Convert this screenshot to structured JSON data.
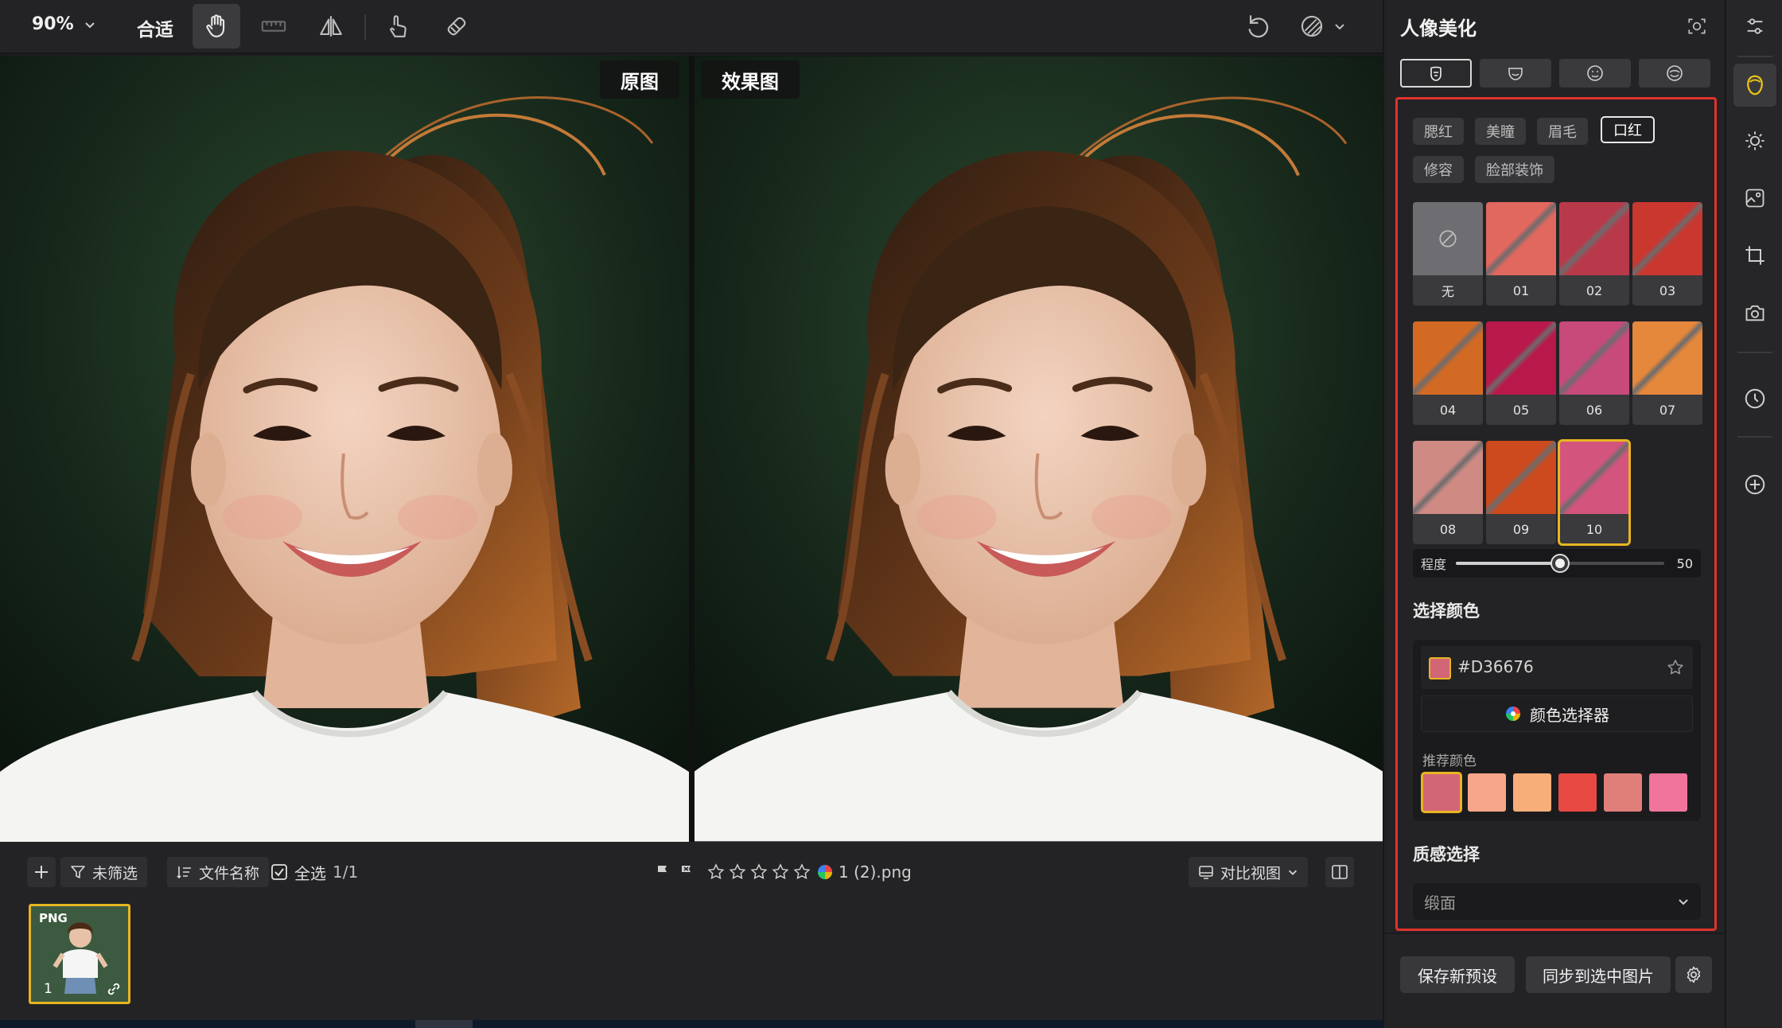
{
  "toolbar": {
    "zoom_value": "90%",
    "fit_label": "合适",
    "tools": [
      "hand-icon",
      "ruler-icon",
      "flip-icon",
      "touch-icon",
      "eraser-icon"
    ],
    "right_tools": [
      "undo-icon",
      "compare-icon"
    ]
  },
  "canvas": {
    "left_label": "原图",
    "right_label": "效果图"
  },
  "filmstrip": {
    "filter_label": "未筛选",
    "sort_label": "文件名称",
    "select_all_label": "全选",
    "selection_count": "1/1",
    "rating_stars": 5,
    "file_name": "1 (2).png",
    "view_label": "对比视图",
    "thumb_badge": "PNG",
    "thumb_index": "1"
  },
  "panel": {
    "title": "人像美化",
    "face_tabs": [
      "face-outline-icon",
      "jaw-icon",
      "eye-face-icon",
      "lips-face-icon"
    ],
    "categories": [
      "腮红",
      "美瞳",
      "眉毛",
      "口红",
      "修容",
      "脸部装饰"
    ],
    "active_category": "口红",
    "swatches": [
      {
        "label": "无",
        "color": "#6e6e72"
      },
      {
        "label": "01",
        "color": "#e0685f"
      },
      {
        "label": "02",
        "color": "#b83a4a"
      },
      {
        "label": "03",
        "color": "#c9372f"
      },
      {
        "label": "04",
        "color": "#d36a24"
      },
      {
        "label": "05",
        "color": "#b8194a"
      },
      {
        "label": "06",
        "color": "#c74a7b"
      },
      {
        "label": "07",
        "color": "#e5883c"
      },
      {
        "label": "08",
        "color": "#cf8a84"
      },
      {
        "label": "09",
        "color": "#cc4a1d"
      },
      {
        "label": "10",
        "color": "#d3557e"
      }
    ],
    "selected_swatch": "10",
    "degree_label": "程度",
    "degree_value": "50",
    "degree_level": 0.5,
    "color_section_title": "选择颜色",
    "hex_value": "#D36676",
    "current_color": "#D36676",
    "color_picker_label": "颜色选择器",
    "recommended_label": "推荐颜色",
    "recommended_colors": [
      "#d36676",
      "#f7a789",
      "#f7ae78",
      "#e84a43",
      "#e07f7a",
      "#f0749b"
    ],
    "texture_section_title": "质感选择",
    "texture_value": "缎面",
    "save_preset_label": "保存新预设",
    "sync_label": "同步到选中图片"
  },
  "rail": {
    "items": [
      "sliders-icon",
      "face-beauty-icon",
      "sun-icon",
      "image-edit-icon",
      "crop-icon",
      "camera-icon",
      "history-icon",
      "add-icon"
    ]
  }
}
